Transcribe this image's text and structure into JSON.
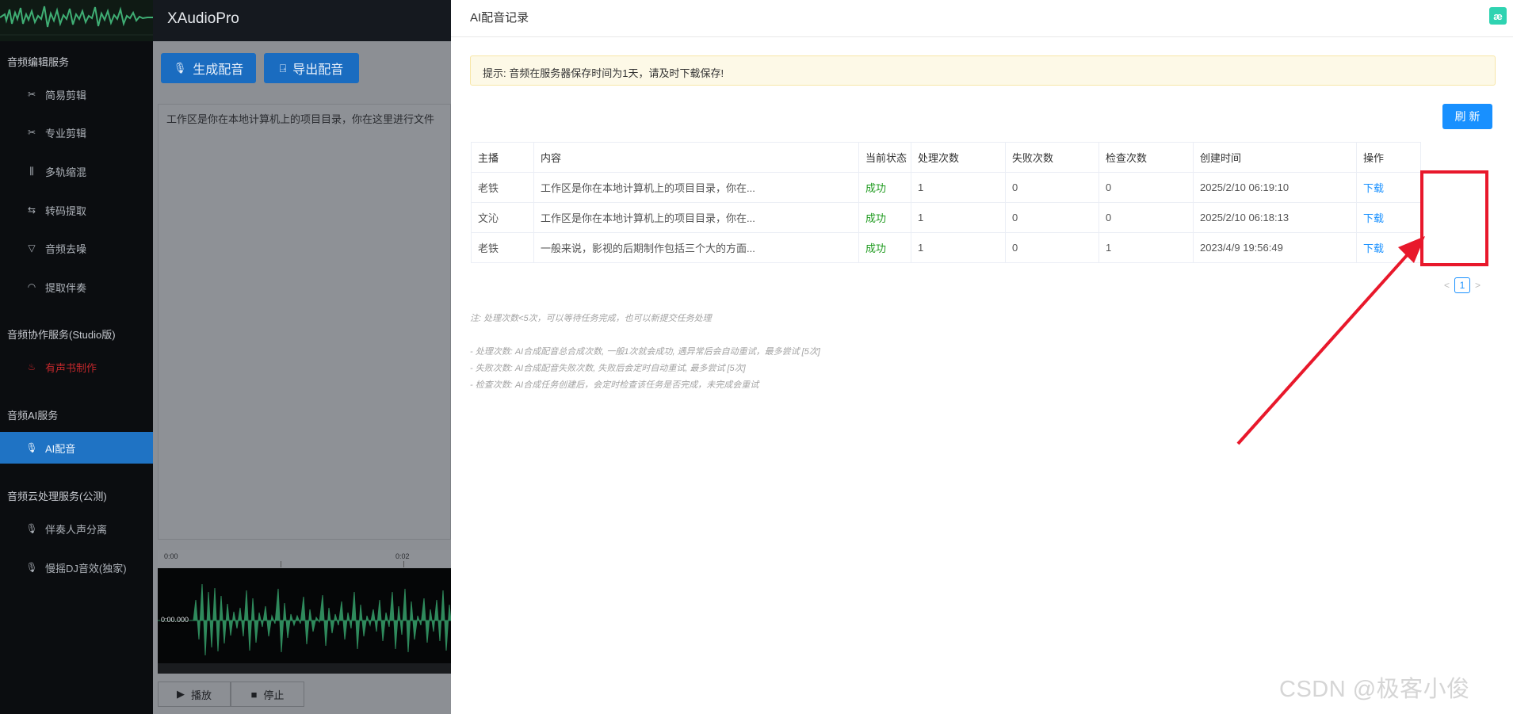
{
  "app": {
    "title": "XAudioPro"
  },
  "sidebar": {
    "groups": [
      {
        "title": "音频编辑服务",
        "items": [
          {
            "label": "简易剪辑",
            "icon": "scissors-icon"
          },
          {
            "label": "专业剪辑",
            "icon": "scissors-icon"
          },
          {
            "label": "多轨缩混",
            "icon": "equalizer-icon"
          },
          {
            "label": "转码提取",
            "icon": "swap-icon"
          },
          {
            "label": "音频去噪",
            "icon": "filter-icon"
          },
          {
            "label": "提取伴奏",
            "icon": "headphones-icon"
          }
        ]
      },
      {
        "title": "音频协作服务(Studio版)",
        "items": [
          {
            "label": "有声书制作",
            "icon": "fire-icon"
          }
        ]
      },
      {
        "title": "音频AI服务",
        "items": [
          {
            "label": "AI配音",
            "icon": "microphone-icon",
            "active": true
          }
        ]
      },
      {
        "title": "音频云处理服务(公测)",
        "items": [
          {
            "label": "伴奏人声分离",
            "icon": "microphone-icon"
          },
          {
            "label": "慢摇DJ音效(独家)",
            "icon": "microphone-icon"
          }
        ]
      }
    ]
  },
  "toolbar": {
    "generate": "生成配音",
    "export": "导出配音"
  },
  "editor": {
    "text": "工作区是你在本地计算机上的项目目录，你在这里进行文件"
  },
  "timeline": {
    "start": "0:00",
    "mid": "0:02",
    "cursor": "0:00.000"
  },
  "player": {
    "play": "播放",
    "stop": "停止"
  },
  "drawer": {
    "title": "AI配音记录",
    "notice": "提示: 音频在服务器保存时间为1天，请及时下载保存!",
    "refresh": "刷 新",
    "table": {
      "headers": [
        "主播",
        "内容",
        "当前状态",
        "处理次数",
        "失败次数",
        "检查次数",
        "创建时间",
        "操作"
      ],
      "rows": [
        [
          "老铁",
          "工作区是你在本地计算机上的项目目录，你在...",
          "成功",
          "1",
          "0",
          "0",
          "2025/2/10 06:19:10",
          "下载"
        ],
        [
          "文沁",
          "工作区是你在本地计算机上的项目目录，你在...",
          "成功",
          "1",
          "0",
          "0",
          "2025/2/10 06:18:13",
          "下载"
        ],
        [
          "老铁",
          "一般来说，影视的后期制作包括三个大的方面...",
          "成功",
          "1",
          "0",
          "1",
          "2023/4/9 19:56:49",
          "下载"
        ]
      ]
    },
    "pagination": {
      "prev": "<",
      "page": "1",
      "next": ">"
    },
    "notes": [
      "注: 处理次数<5次，可以等待任务完成，也可以新提交任务处理",
      "- 处理次数: AI合成配音总合成次数, 一般1次就会成功, 遇异常后会自动重试，最多尝试 [5次]",
      "- 失败次数: AI合成配音失败次数, 失败后会定时自动重试, 最多尝试 [5次]",
      "- 检查次数: AI合成任务创建后，会定时检查该任务是否完成，未完成会重试"
    ]
  },
  "watermark": "CSDN @极客小俊",
  "colors": {
    "accent": "#1890ff",
    "success": "#1f9b1f",
    "annotation": "#e8182b",
    "sidebar_active": "#1f73c4"
  }
}
